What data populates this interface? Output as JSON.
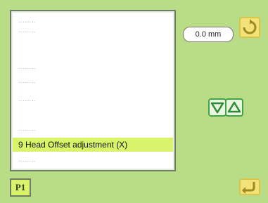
{
  "value_display": {
    "value": "0.0 mm"
  },
  "list": {
    "selected_label": "9 Head Offset adjustment (X)"
  },
  "footer": {
    "page_label": "P1"
  },
  "icons": {
    "rotate": "rotate-icon",
    "confirm": "return-arrow-icon",
    "down": "triangle-down-icon",
    "up": "triangle-up-icon"
  },
  "colors": {
    "background": "#b9dc86",
    "highlight": "#d9f36b",
    "arrow_buttons": "#41a34a",
    "yellow_buttons": "#f3e27a"
  }
}
